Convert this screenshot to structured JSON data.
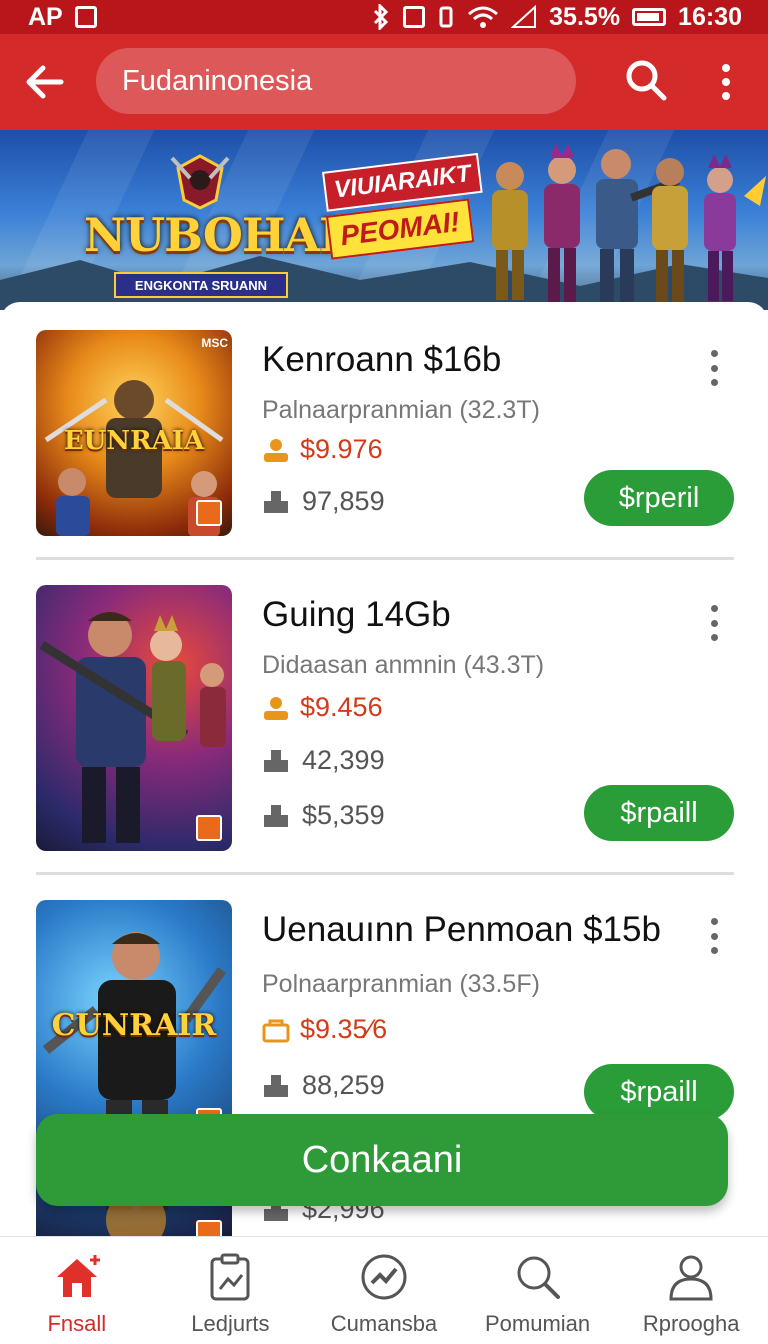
{
  "status_bar": {
    "left_text": "AP",
    "battery": "35.5%",
    "time": "16:30"
  },
  "app_bar": {
    "search_text": "Fudaninonesia"
  },
  "banner": {
    "logo_title": "NUBOHAK",
    "logo_subtitle": "ENGKONTA SRUANN",
    "promo_line1": "VIUIARAIKT",
    "promo_line2": "PEOMAI!"
  },
  "items": [
    {
      "title": "Kenroann $16b",
      "subtitle": "Palnaarpranmian (32.3T)",
      "price": "$9.976",
      "stats": [
        "97,859"
      ],
      "button": "$rperil",
      "thumb_text": "EUNRAIA",
      "thumb_tag": "MSC"
    },
    {
      "title": "Guing 14Gb",
      "subtitle": "Didaasan anmnin (43.3T)",
      "price": "$9.456",
      "stats": [
        "42,399",
        "$5,359"
      ],
      "button": "$rpaill"
    },
    {
      "title": "Uenauınn Penmoan $15b",
      "subtitle": "Polnaarpranmian (33.5F)",
      "price": "$9.35⁄6",
      "stats": [
        "88,259",
        "$2,996"
      ],
      "button": "$rpaill",
      "thumb_text": "CUNRAIR"
    }
  ],
  "floating_button": "Conkaani",
  "bottom_nav": [
    {
      "label": "Fnsall",
      "icon": "home-icon",
      "active": true
    },
    {
      "label": "Ledjurts",
      "icon": "clipboard-icon",
      "active": false
    },
    {
      "label": "Cumansba",
      "icon": "gauge-icon",
      "active": false
    },
    {
      "label": "Pomumian",
      "icon": "search-icon",
      "active": false
    },
    {
      "label": "Rproogha",
      "icon": "profile-icon",
      "active": false
    }
  ],
  "colors": {
    "primary_red": "#d42a2a",
    "status_red": "#b8161b",
    "action_green": "#2a9c38",
    "price_red": "#d23a1a"
  }
}
